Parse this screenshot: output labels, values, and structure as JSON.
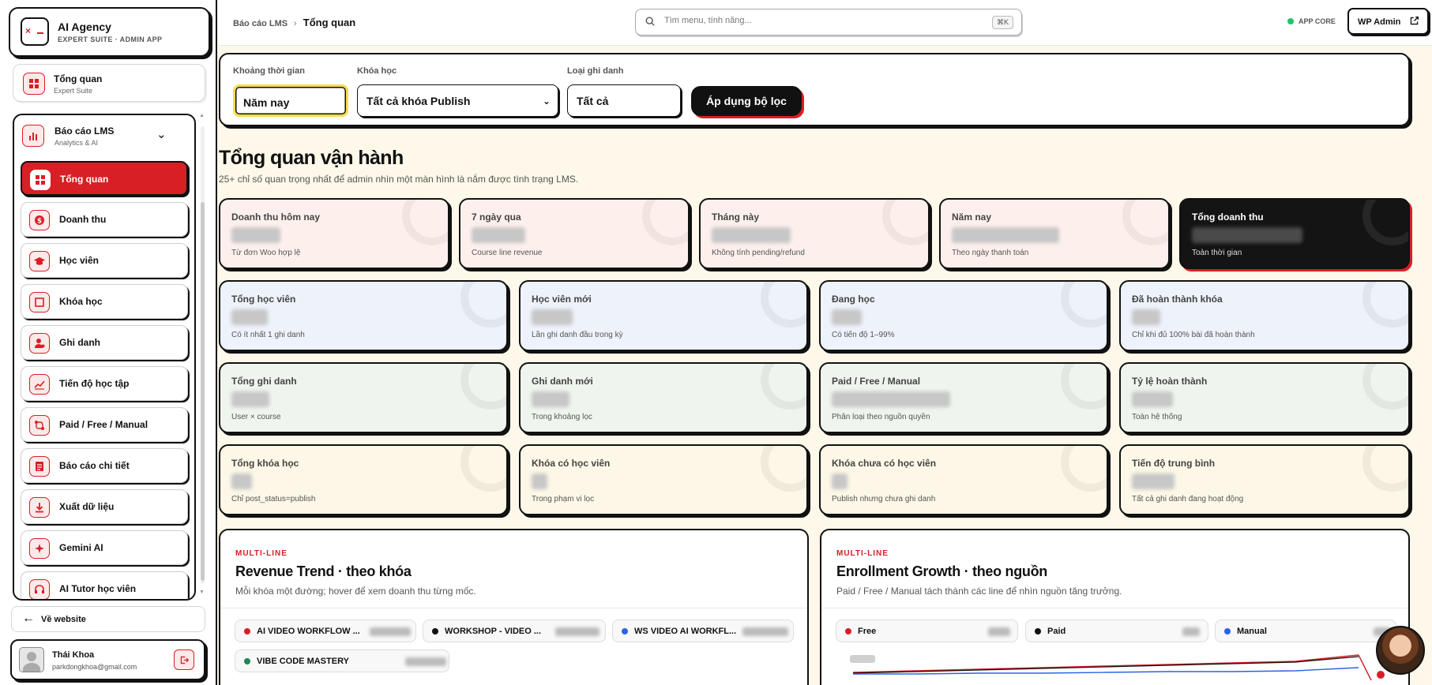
{
  "brand": {
    "title": "AI Agency",
    "subtitle": "EXPERT SUITE · ADMIN APP"
  },
  "nav_top": {
    "title": "Tổng quan",
    "subtitle": "Expert Suite"
  },
  "section": {
    "title": "Báo cáo LMS",
    "subtitle": "Analytics & AI",
    "items": [
      {
        "label": "Tổng quan",
        "icon": "grid-icon",
        "active": true
      },
      {
        "label": "Doanh thu",
        "icon": "dollar-icon"
      },
      {
        "label": "Học viên",
        "icon": "graduation-cap-icon"
      },
      {
        "label": "Khóa học",
        "icon": "square-icon"
      },
      {
        "label": "Ghi danh",
        "icon": "user-icon"
      },
      {
        "label": "Tiến độ học tập",
        "icon": "trend-icon"
      },
      {
        "label": "Paid / Free / Manual",
        "icon": "split-icon"
      },
      {
        "label": "Báo cáo chi tiết",
        "icon": "report-icon"
      },
      {
        "label": "Xuất dữ liệu",
        "icon": "download-icon"
      },
      {
        "label": "Gemini AI",
        "icon": "sparkle-icon"
      },
      {
        "label": "AI Tutor học viên",
        "icon": "headset-icon"
      }
    ]
  },
  "back_link": "Về website",
  "user": {
    "name": "Thái Khoa",
    "email": "parkdongkhoa@gmail.com"
  },
  "topbar": {
    "crumb_parent": "Báo cáo LMS",
    "crumb_current": "Tổng quan",
    "search_placeholder": "Tìm menu, tính năng...",
    "search_shortcut": "⌘K",
    "status": "APP CORE",
    "wp_admin": "WP Admin"
  },
  "filters": {
    "period_label": "Khoảng thời gian",
    "period_value": "Năm nay",
    "course_label": "Khóa học",
    "course_value": "Tất cả khóa Publish",
    "type_label": "Loại ghi danh",
    "type_value": "Tất cả",
    "apply": "Áp dụng bộ lọc"
  },
  "headline": "Tổng quan vận hành",
  "subheadline": "25+ chỉ số quan trọng nhất để admin nhìn một màn hình là nắm được tình trạng LMS.",
  "revenue_cards": [
    {
      "title": "Doanh thu hôm nay",
      "sub": "Từ đơn Woo hợp lệ"
    },
    {
      "title": "7 ngày qua",
      "sub": "Course line revenue"
    },
    {
      "title": "Tháng này",
      "sub": "Không tính pending/refund"
    },
    {
      "title": "Năm nay",
      "sub": "Theo ngày thanh toán"
    },
    {
      "title": "Tổng doanh thu",
      "sub": "Toàn thời gian"
    }
  ],
  "stat_rows": [
    [
      {
        "title": "Tổng học viên",
        "sub": "Có ít nhất 1 ghi danh"
      },
      {
        "title": "Học viên mới",
        "sub": "Lần ghi danh đầu trong kỳ"
      },
      {
        "title": "Đang học",
        "sub": "Có tiến độ 1–99%"
      },
      {
        "title": "Đã hoàn thành khóa",
        "sub": "Chỉ khi đủ 100% bài đã hoàn thành"
      }
    ],
    [
      {
        "title": "Tổng ghi danh",
        "sub": "User × course"
      },
      {
        "title": "Ghi danh mới",
        "sub": "Trong khoảng lọc"
      },
      {
        "title": "Paid / Free / Manual",
        "sub": "Phân loại theo nguồn quyền"
      },
      {
        "title": "Tỷ lệ hoàn thành",
        "sub": "Toàn hệ thống"
      }
    ],
    [
      {
        "title": "Tổng khóa học",
        "sub": "Chỉ post_status=publish"
      },
      {
        "title": "Khóa có học viên",
        "sub": "Trong phạm vi lọc"
      },
      {
        "title": "Khóa chưa có học viên",
        "sub": "Publish nhưng chưa ghi danh"
      },
      {
        "title": "Tiến độ trung bình",
        "sub": "Tất cả ghi danh đang hoạt động"
      }
    ]
  ],
  "revenue_chart": {
    "kicker": "MULTI-LINE",
    "title": "Revenue Trend · theo khóa",
    "sub": "Mỗi khóa một đường; hover để xem doanh thu từng mốc.",
    "legend": [
      {
        "name": "AI VIDEO WORKFLOW ...",
        "color": "#d81f26"
      },
      {
        "name": "WORKSHOP - VIDEO ...",
        "color": "#111111"
      },
      {
        "name": "WS VIDEO AI WORKFL...",
        "color": "#2b63e6"
      },
      {
        "name": "VIBE CODE MASTERY",
        "color": "#1a8a54"
      }
    ]
  },
  "enrollment_chart": {
    "kicker": "MULTI-LINE",
    "title": "Enrollment Growth · theo nguồn",
    "sub": "Paid / Free / Manual tách thành các line để nhìn nguồn tăng trưởng.",
    "legend": [
      {
        "name": "Free",
        "color": "#d81f26"
      },
      {
        "name": "Paid",
        "color": "#111111"
      },
      {
        "name": "Manual",
        "color": "#2b63e6"
      }
    ]
  },
  "colors": {
    "accent": "#d81f26",
    "dark": "#141414",
    "highlight": "#f7dc4e"
  }
}
